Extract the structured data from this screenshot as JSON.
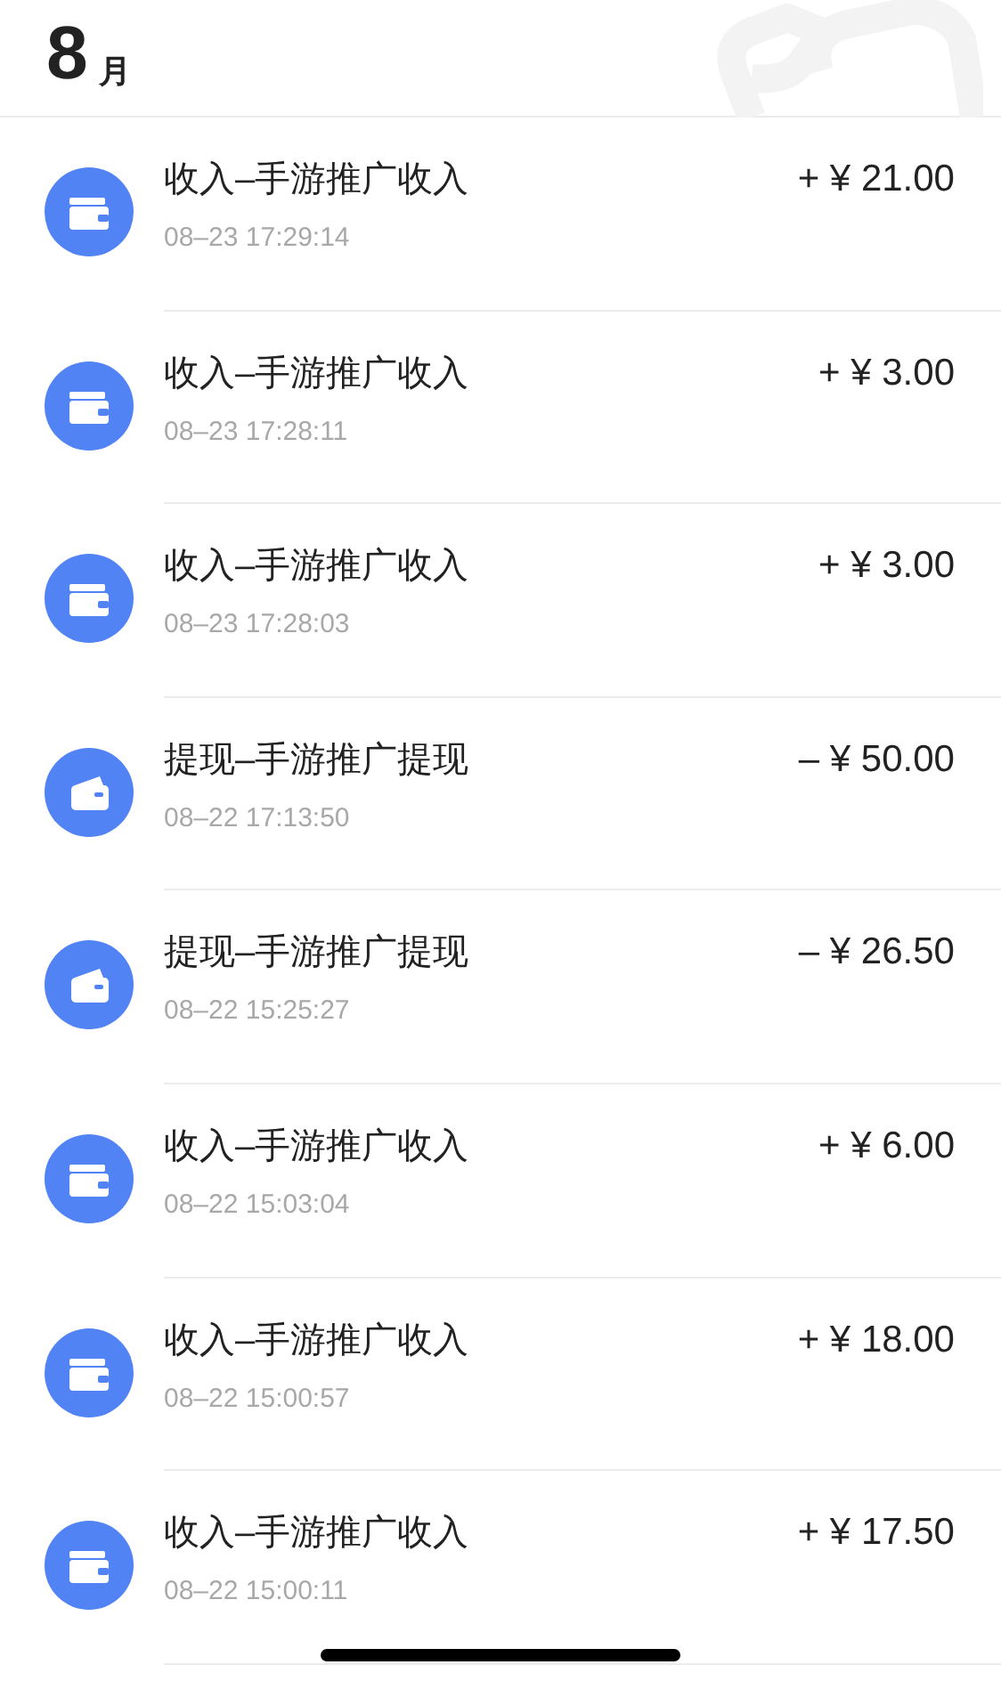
{
  "header": {
    "month_number": "8",
    "month_unit": "月"
  },
  "transactions": [
    {
      "kind": "income",
      "title": "收入–手游推广收入",
      "time": "08–23 17:29:14",
      "amount": "+ ¥ 21.00"
    },
    {
      "kind": "income",
      "title": "收入–手游推广收入",
      "time": "08–23 17:28:11",
      "amount": "+ ¥ 3.00"
    },
    {
      "kind": "income",
      "title": "收入–手游推广收入",
      "time": "08–23 17:28:03",
      "amount": "+ ¥ 3.00"
    },
    {
      "kind": "withdraw",
      "title": "提现–手游推广提现",
      "time": "08–22 17:13:50",
      "amount": "– ¥ 50.00"
    },
    {
      "kind": "withdraw",
      "title": "提现–手游推广提现",
      "time": "08–22 15:25:27",
      "amount": "– ¥ 26.50"
    },
    {
      "kind": "income",
      "title": "收入–手游推广收入",
      "time": "08–22 15:03:04",
      "amount": "+ ¥ 6.00"
    },
    {
      "kind": "income",
      "title": "收入–手游推广收入",
      "time": "08–22 15:00:57",
      "amount": "+ ¥ 18.00"
    },
    {
      "kind": "income",
      "title": "收入–手游推广收入",
      "time": "08–22 15:00:11",
      "amount": "+ ¥ 17.50"
    }
  ]
}
